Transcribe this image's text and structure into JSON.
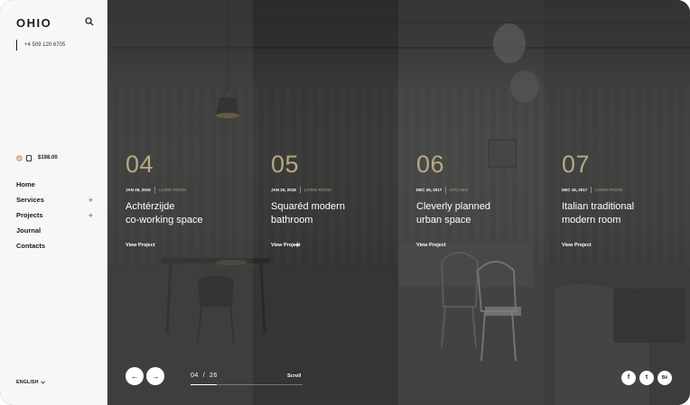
{
  "brand": {
    "logo": "OHIO"
  },
  "header": {
    "phone": "+4 509 120 6705"
  },
  "cart": {
    "count": "0",
    "total": "$198.00"
  },
  "nav": {
    "items": [
      {
        "label": "Home",
        "plus": ""
      },
      {
        "label": "Services",
        "plus": "+"
      },
      {
        "label": "Projects",
        "plus": "+"
      },
      {
        "label": "Journal",
        "plus": ""
      },
      {
        "label": "Contacts",
        "plus": ""
      }
    ]
  },
  "language": {
    "label": "ENGLISH"
  },
  "projects": [
    {
      "number": "04",
      "date": "JAN 26, 2015",
      "category": "LIVING ROOM",
      "title_line1": "Achtérzijde",
      "title_line2": "co-working space",
      "link": "View Project"
    },
    {
      "number": "05",
      "date": "JAN 20, 2018",
      "category": "LIVING ROOM",
      "title_line1": "Squaréd modern",
      "title_line2": "bathroom",
      "link": "View Project",
      "plus": "+"
    },
    {
      "number": "06",
      "date": "DEC 26, 2017",
      "category": "KITCHEN",
      "title_line1": "Cleverly planned",
      "title_line2": "urban space",
      "link": "View Project"
    },
    {
      "number": "07",
      "date": "DEC 16, 2017",
      "category": "LIVING ROOM",
      "title_line1": "Italian traditional",
      "title_line2": "modern room",
      "link": "View Project"
    }
  ],
  "pager": {
    "current": "04",
    "separator": "/",
    "total": "26",
    "progress": 0.23,
    "scroll_label": "Scroll"
  },
  "arrows": {
    "prev": "←",
    "next": "→"
  },
  "social": {
    "facebook": "f",
    "twitter": "t",
    "behance": "Bē"
  },
  "colors": {
    "accent": "#b7a881",
    "sidebar": "#f7f7f7",
    "overlay": "#3a3a39"
  }
}
